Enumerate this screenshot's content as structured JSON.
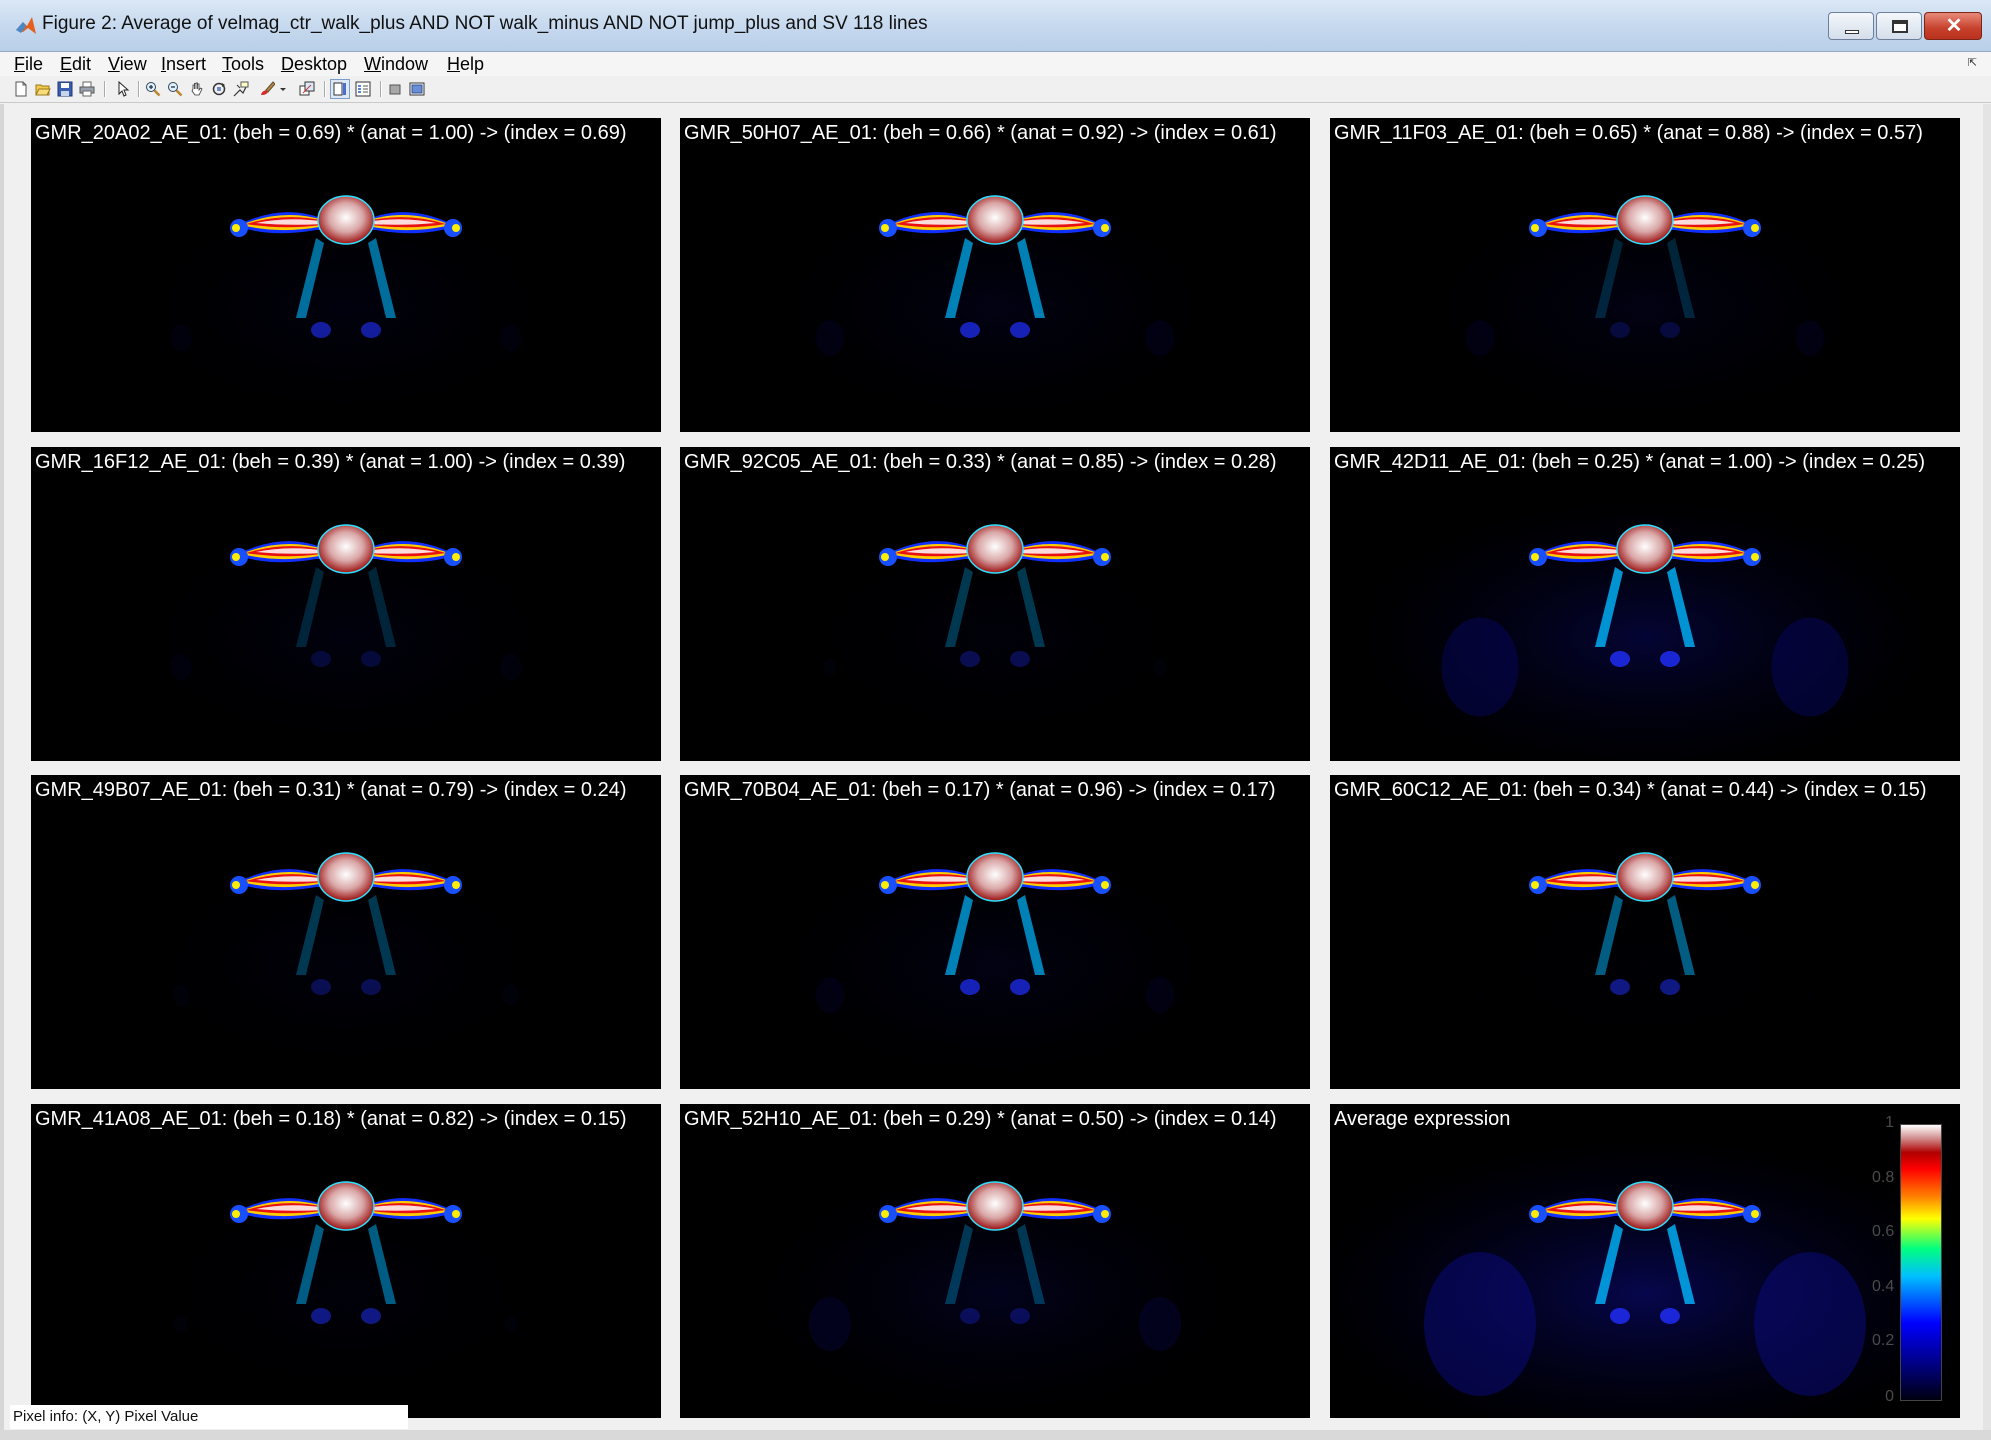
{
  "window": {
    "title": "Figure 2: Average of velmag_ctr_walk_plus AND NOT walk_minus AND NOT jump_plus and SV 118 lines",
    "controls": {
      "close": "✕"
    }
  },
  "menu": {
    "items": [
      {
        "acc": "F",
        "rest": "ile"
      },
      {
        "acc": "E",
        "rest": "dit"
      },
      {
        "acc": "V",
        "rest": "iew"
      },
      {
        "acc": "I",
        "rest": "nsert"
      },
      {
        "acc": "T",
        "rest": "ools"
      },
      {
        "acc": "D",
        "rest": "esktop"
      },
      {
        "acc": "W",
        "rest": "indow"
      },
      {
        "acc": "H",
        "rest": "elp"
      }
    ],
    "overflow_arrow": "⇱"
  },
  "toolbar": {
    "icons": [
      "new-figure-icon",
      "open-file-icon",
      "save-icon",
      "print-icon",
      "edit-plot-arrow-icon",
      "zoom-in-icon",
      "zoom-out-icon",
      "pan-hand-icon",
      "rotate-3d-icon",
      "data-cursor-icon",
      "brush-icon",
      "brush-dropdown-icon",
      "link-plot-icon",
      "colorbar-toggle-icon",
      "legend-toggle-icon",
      "hide-plot-tools-icon",
      "show-plot-tools-icon"
    ]
  },
  "panels": [
    {
      "title": "GMR_20A02_AE_01: (beh = 0.69) * (anat = 1.00) -> (index = 0.69)",
      "background_level": 0.15,
      "lobe_level": 0.6
    },
    {
      "title": "GMR_50H07_AE_01: (beh = 0.66) * (anat = 0.92) -> (index = 0.61)",
      "background_level": 0.2,
      "lobe_level": 0.7
    },
    {
      "title": "GMR_11F03_AE_01: (beh = 0.65) * (anat = 0.88) -> (index = 0.57)",
      "background_level": 0.2,
      "lobe_level": 0.2
    },
    {
      "title": "GMR_16F12_AE_01: (beh = 0.39) * (anat = 1.00) -> (index = 0.39)",
      "background_level": 0.15,
      "lobe_level": 0.2
    },
    {
      "title": "GMR_92C05_AE_01: (beh = 0.33) * (anat = 0.85) -> (index = 0.28)",
      "background_level": 0.1,
      "lobe_level": 0.3
    },
    {
      "title": "GMR_42D11_AE_01: (beh = 0.25) * (anat = 1.00) -> (index = 0.25)",
      "background_level": 0.55,
      "lobe_level": 0.8
    },
    {
      "title": "GMR_49B07_AE_01: (beh = 0.31) * (anat = 0.79) -> (index = 0.24)",
      "background_level": 0.12,
      "lobe_level": 0.3
    },
    {
      "title": "GMR_70B04_AE_01: (beh = 0.17) * (anat = 0.96) -> (index = 0.17)",
      "background_level": 0.2,
      "lobe_level": 0.7
    },
    {
      "title": "GMR_60C12_AE_01: (beh = 0.34) * (anat = 0.44) -> (index = 0.15)",
      "background_level": 0.05,
      "lobe_level": 0.5
    },
    {
      "title": "GMR_41A08_AE_01: (beh = 0.18) * (anat = 0.82) -> (index = 0.15)",
      "background_level": 0.1,
      "lobe_level": 0.5
    },
    {
      "title": "GMR_52H10_AE_01: (beh = 0.29) * (anat = 0.50) -> (index = 0.14)",
      "background_level": 0.3,
      "lobe_level": 0.3
    },
    {
      "title": "Average expression",
      "background_level": 0.8,
      "lobe_level": 0.8
    }
  ],
  "colorbar": {
    "ticks": [
      "1",
      "0.8",
      "0.6",
      "0.4",
      "0.2",
      "0"
    ],
    "colormap": [
      "#000010",
      "#0000ff",
      "#00bfff",
      "#00ff80",
      "#ffff00",
      "#ff8000",
      "#ff0000",
      "#ffffff"
    ]
  },
  "status": {
    "pixel_info": "Pixel info: (X, Y)  Pixel Value"
  }
}
